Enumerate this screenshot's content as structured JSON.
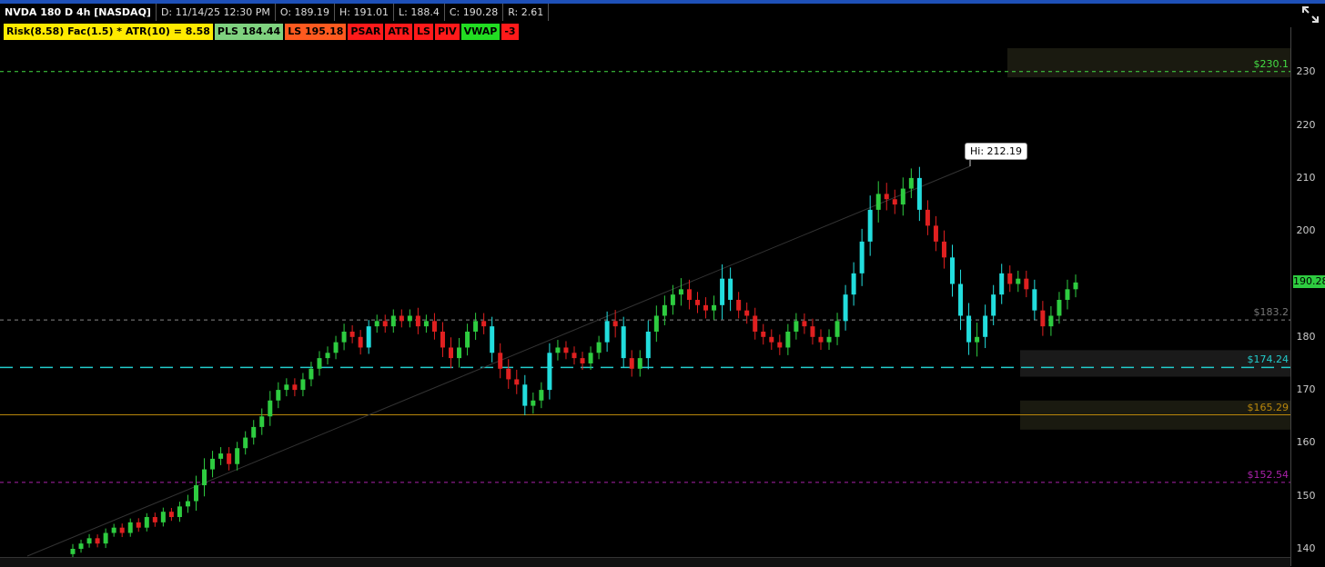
{
  "header": {
    "symbol": "NVDA 180 D 4h [NASDAQ]",
    "date": "D: 11/14/25 12:30 PM",
    "open": "O: 189.19",
    "high": "H: 191.01",
    "low": "L: 188.4",
    "close": "C: 190.28",
    "range": "R: 2.61"
  },
  "studies": [
    {
      "label": "Risk(8.58) Fac(1.5) * ATR(10) = 8.58",
      "bg": "#ffea00",
      "fg": "#000000"
    },
    {
      "label": "PLS 184.44",
      "bg": "#7fd27f",
      "fg": "#000000"
    },
    {
      "label": "LS 195.18",
      "bg": "#ff5a1f",
      "fg": "#000000"
    },
    {
      "label": "PSAR",
      "bg": "#ff1a1a",
      "fg": "#000000"
    },
    {
      "label": "ATR",
      "bg": "#ff1a1a",
      "fg": "#000000"
    },
    {
      "label": "LS",
      "bg": "#ff1a1a",
      "fg": "#000000"
    },
    {
      "label": "PIV",
      "bg": "#ff1a1a",
      "fg": "#000000"
    },
    {
      "label": "VWAP",
      "bg": "#22dd22",
      "fg": "#000000"
    },
    {
      "label": "-3",
      "bg": "#ff1a1a",
      "fg": "#000000"
    }
  ],
  "chart_data": {
    "type": "candlestick",
    "ylim": [
      138,
      238
    ],
    "yticks": [
      140,
      150,
      160,
      170,
      180,
      190,
      200,
      210,
      220,
      230
    ],
    "last_price": "190.28",
    "high_marker": "Hi: 212.19",
    "levels": [
      {
        "value": 230.1,
        "label": "$230.1",
        "color": "#44dd44",
        "style": "dashed"
      },
      {
        "value": 183.2,
        "label": "$183.2",
        "color": "#888888",
        "style": "dashed"
      },
      {
        "value": 174.24,
        "label": "$174.24",
        "color": "#22cccc",
        "style": "longdash"
      },
      {
        "value": 165.29,
        "label": "$165.29",
        "color": "#b8860b",
        "style": "solid"
      },
      {
        "value": 152.54,
        "label": "$152.54",
        "color": "#aa22aa",
        "style": "dashed"
      }
    ],
    "zones": [
      {
        "low": 229,
        "high": 234.5,
        "color": "#1a1a10"
      },
      {
        "low": 172.5,
        "high": 177.5,
        "color": "#1a1a1a"
      },
      {
        "low": 162.5,
        "high": 168,
        "color": "#1a1a10"
      }
    ],
    "closes": [
      140,
      141,
      142,
      141,
      143,
      144,
      143,
      145,
      144,
      146,
      145,
      147,
      146,
      148,
      149,
      152,
      155,
      157,
      158,
      156,
      159,
      161,
      163,
      165,
      168,
      170,
      171,
      170,
      172,
      174,
      176,
      177,
      179,
      181,
      180,
      178,
      182,
      183,
      182,
      184,
      183,
      184,
      182,
      183,
      181,
      178,
      176,
      178,
      181,
      183,
      182,
      177,
      174,
      172,
      171,
      167,
      168,
      170,
      177,
      178,
      177,
      176,
      175,
      177,
      179,
      183,
      182,
      176,
      174,
      176,
      181,
      184,
      186,
      188,
      189,
      187,
      186,
      185,
      186,
      191,
      187,
      185,
      184,
      181,
      180,
      179,
      178,
      181,
      183,
      182,
      180,
      179,
      180,
      183,
      188,
      192,
      198,
      204,
      207,
      206,
      205,
      208,
      210,
      204,
      201,
      198,
      195,
      190,
      184,
      179,
      180,
      184,
      188,
      192,
      190,
      191,
      189,
      185,
      182,
      184,
      187,
      189,
      190.28
    ],
    "volatility": [
      1.5,
      1.2,
      1.3,
      1.2,
      1.4,
      1.2,
      1.3,
      1.2,
      1.3,
      1.2,
      1.4,
      1.3,
      1.2,
      1.5,
      2,
      3,
      3.5,
      2.5,
      2,
      2,
      2,
      2,
      2.2,
      2.5,
      3,
      2.4,
      2,
      2,
      2,
      2.2,
      2.2,
      2,
      2,
      2.5,
      2,
      2.2,
      2,
      2,
      2,
      2,
      2,
      2,
      2.5,
      2,
      2.5,
      3,
      3.2,
      3,
      2.5,
      2.6,
      2.5,
      3,
      3,
      3,
      3,
      3,
      2.5,
      2.4,
      3,
      2.4,
      2,
      2,
      2,
      2,
      2,
      3,
      3.5,
      3,
      2.5,
      2.5,
      3.5,
      3.2,
      3,
      3,
      3.5,
      3,
      2.5,
      2.5,
      3,
      4.5,
      3.5,
      2.5,
      2.5,
      2.5,
      2.4,
      2.4,
      2.4,
      2.4,
      2.5,
      2.4,
      2.4,
      2.4,
      2.4,
      2.6,
      3,
      3.5,
      4,
      4.5,
      4,
      3.5,
      3,
      3.5,
      3,
      3.5,
      3,
      3,
      3.5,
      4,
      4.5,
      4,
      4.5,
      3.5,
      3,
      3,
      2.5,
      2.5,
      2.5,
      3,
      3,
      3,
      2.5,
      3,
      2.5
    ]
  }
}
